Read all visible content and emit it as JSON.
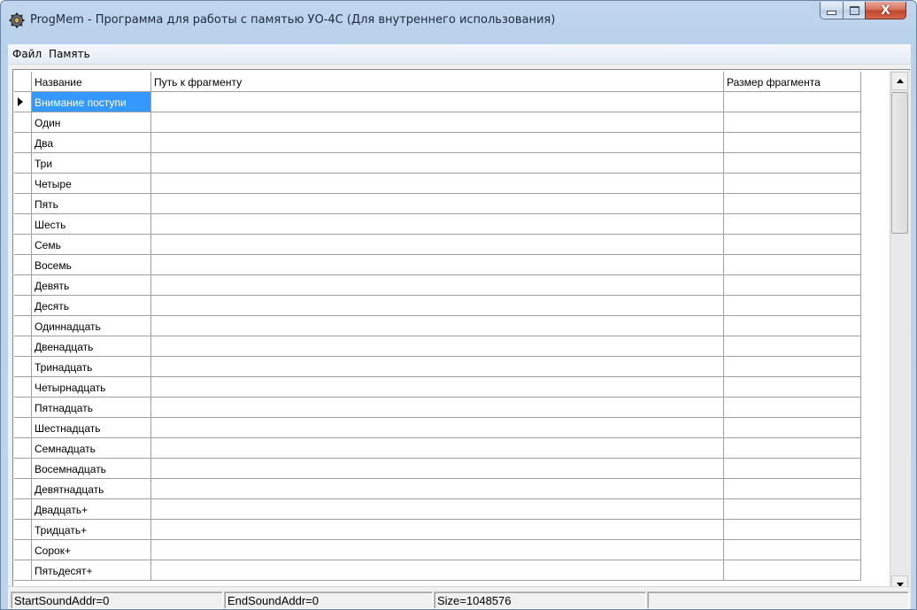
{
  "window": {
    "title": "ProgMem - Программа для работы с памятью УО-4С (Для внутреннего использования)",
    "min_icon": "minimize-icon",
    "max_icon": "maximize-icon",
    "close_icon": "close-icon",
    "close_glyph": "X"
  },
  "menu": {
    "items": [
      {
        "label": "Файл"
      },
      {
        "label": "Память"
      }
    ]
  },
  "grid": {
    "columns": [
      {
        "label": "Название"
      },
      {
        "label": "Путь к фрагменту"
      },
      {
        "label": "Размер фрагмента"
      }
    ],
    "rows": [
      {
        "name": "Внимание поступи",
        "path": "",
        "size": ""
      },
      {
        "name": "Один",
        "path": "",
        "size": ""
      },
      {
        "name": "Два",
        "path": "",
        "size": ""
      },
      {
        "name": "Три",
        "path": "",
        "size": ""
      },
      {
        "name": "Четыре",
        "path": "",
        "size": ""
      },
      {
        "name": "Пять",
        "path": "",
        "size": ""
      },
      {
        "name": "Шесть",
        "path": "",
        "size": ""
      },
      {
        "name": "Семь",
        "path": "",
        "size": ""
      },
      {
        "name": "Восемь",
        "path": "",
        "size": ""
      },
      {
        "name": "Девять",
        "path": "",
        "size": ""
      },
      {
        "name": "Десять",
        "path": "",
        "size": ""
      },
      {
        "name": "Одиннадцать",
        "path": "",
        "size": ""
      },
      {
        "name": "Двенадцать",
        "path": "",
        "size": ""
      },
      {
        "name": "Тринадцать",
        "path": "",
        "size": ""
      },
      {
        "name": "Четырнадцать",
        "path": "",
        "size": ""
      },
      {
        "name": "Пятнадцать",
        "path": "",
        "size": ""
      },
      {
        "name": "Шестнадцать",
        "path": "",
        "size": ""
      },
      {
        "name": "Семнадцать",
        "path": "",
        "size": ""
      },
      {
        "name": "Восемнадцать",
        "path": "",
        "size": ""
      },
      {
        "name": "Девятнадцать",
        "path": "",
        "size": ""
      },
      {
        "name": "Двадцать+",
        "path": "",
        "size": ""
      },
      {
        "name": "Тридцать+",
        "path": "",
        "size": ""
      },
      {
        "name": "Сорок+",
        "path": "",
        "size": ""
      },
      {
        "name": "Пятьдесят+",
        "path": "",
        "size": ""
      }
    ]
  },
  "status": {
    "start": "StartSoundAddr=0",
    "end": "EndSoundAddr=0",
    "size": "Size=1048576"
  },
  "colors": {
    "selection": "#3399ff",
    "title_bar": "#b9d1ea",
    "close_button": "#c1452d"
  }
}
